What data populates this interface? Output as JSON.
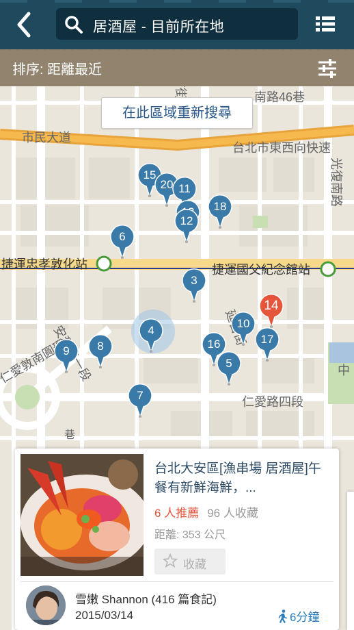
{
  "header": {
    "search_text": "居酒屋 - 目前所在地",
    "back_icon": "chevron-left-icon",
    "list_icon": "list-view-icon"
  },
  "sortbar": {
    "label": "排序: 距離最近",
    "filter_icon": "sliders-icon"
  },
  "map": {
    "redo_search_label": "在此區域重新搜尋",
    "street_labels": {
      "nanjing": "南路46巷",
      "yanji": "延吉街",
      "shimin": "市民大道",
      "expressway": "台北市東西向快速",
      "guangfu": "光復南路",
      "mrt_zhongxiao": "捷運忠孝敦化站",
      "mrt_sunyatsen": "捷運國父紀念館站",
      "renai_circle": "仁愛敦南圓環",
      "renai_4": "仁愛路四段",
      "anhe": "安和路一段",
      "yanji2": "延吉街",
      "zhong": "中",
      "lane": "巷"
    },
    "pins": [
      {
        "label": "15",
        "color": "#3a7aa8"
      },
      {
        "label": "20",
        "color": "#3a7aa8"
      },
      {
        "label": "11",
        "color": "#3a7aa8"
      },
      {
        "label": "13",
        "color": "#3a7aa8"
      },
      {
        "label": "18",
        "color": "#3a7aa8"
      },
      {
        "label": "12",
        "color": "#3a7aa8"
      },
      {
        "label": "6",
        "color": "#3a7aa8"
      },
      {
        "label": "3",
        "color": "#3a7aa8"
      },
      {
        "label": "10",
        "color": "#3a7aa8"
      },
      {
        "label": "14",
        "color": "#e4553b"
      },
      {
        "label": "17",
        "color": "#3a7aa8"
      },
      {
        "label": "4",
        "color": "#3a7aa8"
      },
      {
        "label": "16",
        "color": "#3a7aa8"
      },
      {
        "label": "5",
        "color": "#3a7aa8"
      },
      {
        "label": "9",
        "color": "#3a7aa8"
      },
      {
        "label": "8",
        "color": "#3a7aa8"
      },
      {
        "label": "7",
        "color": "#3a7aa8"
      }
    ]
  },
  "card": {
    "title": "台北大安區[漁串場 居酒屋]午餐有新鮮海鮮，...",
    "recommend": "6 人推薦",
    "favorites": "96 人收藏",
    "distance": "距離: 353 公尺",
    "save_label": "收藏",
    "author": "雪嫩 Shannon (416 篇食記)",
    "date": "2015/03/14",
    "walk_time": "6分鐘"
  },
  "colors": {
    "header_bg": "#1f4a5e",
    "pin_blue": "#3a7aa8",
    "pin_red": "#e4553b",
    "link_blue": "#2a7ec0"
  }
}
